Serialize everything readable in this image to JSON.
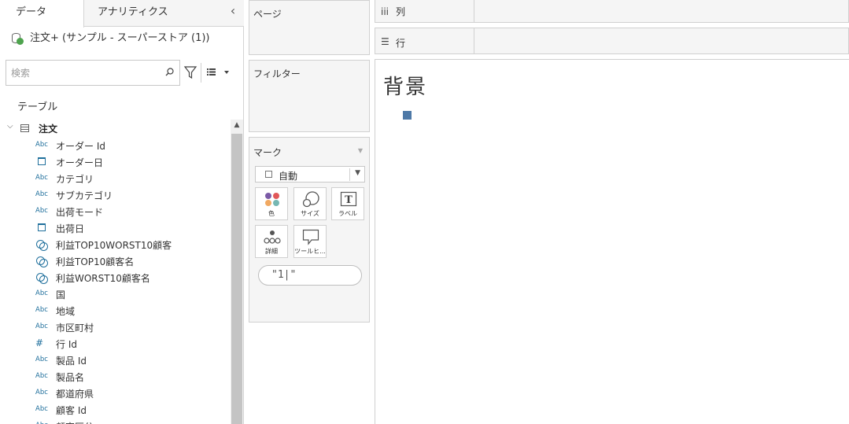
{
  "left_pane": {
    "tabs": {
      "data": "データ",
      "analytics": "アナリティクス"
    },
    "collapse_glyph": "‹",
    "datasource": "注文+ (サンプル - スーパーストア (1))",
    "search_placeholder": "検索",
    "tables_label": "テーブル",
    "table": {
      "name": "注文"
    },
    "fields": [
      {
        "type": "abc",
        "name": "オーダー Id"
      },
      {
        "type": "date",
        "name": "オーダー日"
      },
      {
        "type": "abc",
        "name": "カテゴリ"
      },
      {
        "type": "abc",
        "name": "サブカテゴリ"
      },
      {
        "type": "abc",
        "name": "出荷モード"
      },
      {
        "type": "date",
        "name": "出荷日"
      },
      {
        "type": "set",
        "name": "利益TOP10WORST10顧客"
      },
      {
        "type": "set",
        "name": "利益TOP10顧客名"
      },
      {
        "type": "set",
        "name": "利益WORST10顧客名"
      },
      {
        "type": "abc",
        "name": "国"
      },
      {
        "type": "abc",
        "name": "地域"
      },
      {
        "type": "abc",
        "name": "市区町村"
      },
      {
        "type": "number",
        "name": "行 Id"
      },
      {
        "type": "abc",
        "name": "製品 Id"
      },
      {
        "type": "abc",
        "name": "製品名"
      },
      {
        "type": "abc",
        "name": "都道府県"
      },
      {
        "type": "abc",
        "name": "顧客 Id"
      },
      {
        "type": "abc",
        "name": "顧客区分"
      }
    ],
    "abc_label": "Abc",
    "number_label": "#"
  },
  "cards": {
    "pages": "ページ",
    "filters": "フィルター",
    "marks": {
      "title": "マーク",
      "mark_type": "自動",
      "buttons": {
        "color": "色",
        "size": "サイズ",
        "label": "ラベル",
        "detail": "詳細",
        "tooltip": "ツールヒ..."
      },
      "pill_value": "\"1|\""
    }
  },
  "shelves": {
    "columns": "列",
    "rows": "行"
  },
  "view": {
    "title": "背景",
    "mark_color": "#4e79a7"
  },
  "colors": {
    "accent": "#1f6f9c",
    "mark": "#4e79a7"
  }
}
